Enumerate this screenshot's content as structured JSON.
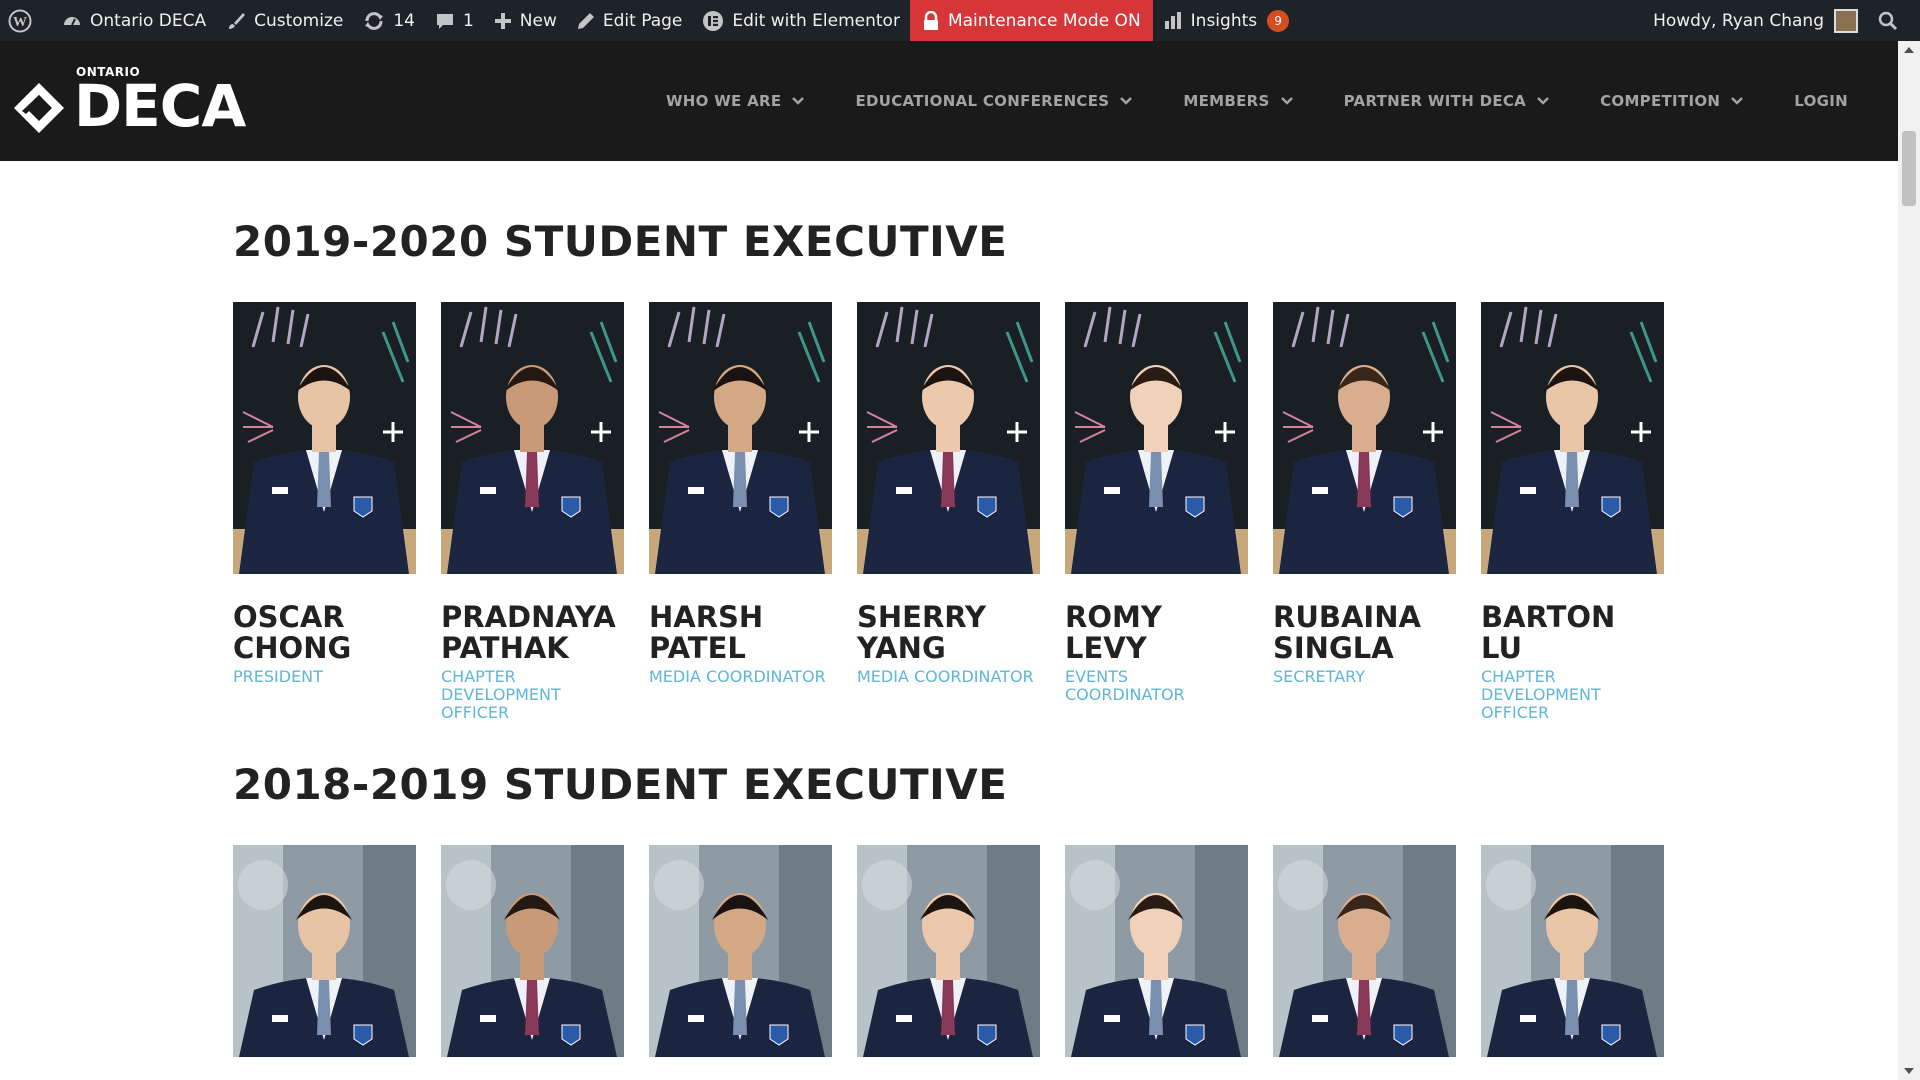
{
  "adminbar": {
    "site_name": "Ontario DECA",
    "customize": "Customize",
    "updates_count": "14",
    "comments_count": "1",
    "new_label": "New",
    "edit_page": "Edit Page",
    "elementor": "Edit with Elementor",
    "maintenance": "Maintenance Mode ON",
    "insights": "Insights",
    "insights_badge": "9",
    "howdy": "Howdy, Ryan Chang"
  },
  "header": {
    "logo_small": "ONTARIO",
    "logo_big": "DECA",
    "nav": [
      {
        "label": "WHO WE ARE",
        "dropdown": true
      },
      {
        "label": "EDUCATIONAL CONFERENCES",
        "dropdown": true
      },
      {
        "label": "MEMBERS",
        "dropdown": true
      },
      {
        "label": "PARTNER WITH DECA",
        "dropdown": true
      },
      {
        "label": "COMPETITION",
        "dropdown": true
      },
      {
        "label": "LOGIN",
        "dropdown": false
      }
    ]
  },
  "sections": [
    {
      "title": "2019-2020 STUDENT EXECUTIVE",
      "members": [
        {
          "name": "OSCAR CHONG",
          "role": "PRESIDENT"
        },
        {
          "name": "PRADNAYA PATHAK",
          "role": "CHAPTER DEVELOPMENT OFFICER"
        },
        {
          "name": "HARSH PATEL",
          "role": "MEDIA COORDINATOR"
        },
        {
          "name": "SHERRY YANG",
          "role": "MEDIA COORDINATOR"
        },
        {
          "name": "ROMY LEVY",
          "role": "EVENTS COORDINATOR"
        },
        {
          "name": "RUBAINA SINGLA",
          "role": "SECRETARY"
        },
        {
          "name": "BARTON LU",
          "role": "CHAPTER DEVELOPMENT OFFICER"
        }
      ]
    },
    {
      "title": "2018-2019 STUDENT EXECUTIVE",
      "members": [
        {},
        {},
        {},
        {},
        {},
        {},
        {}
      ]
    }
  ],
  "colors": {
    "adminbar_bg": "#1d2327",
    "maintenance_bg": "#d63638",
    "header_bg": "#1a1a1a",
    "role_text": "#5eb6d9",
    "blazer": "#1c2540"
  }
}
